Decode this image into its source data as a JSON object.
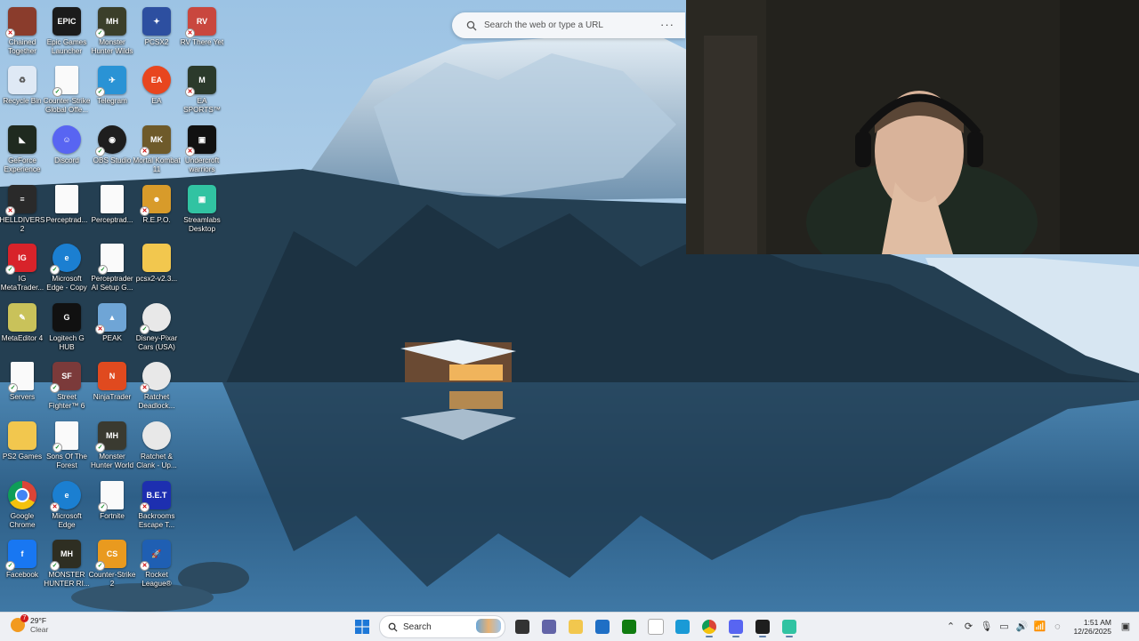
{
  "desktop_icons": [
    {
      "label": "Chained Together",
      "icon": "chained-together-icon",
      "color": "#8a3c2c",
      "glyph": "",
      "badge": "x"
    },
    {
      "label": "Epic Games Launcher",
      "icon": "epic-games-icon",
      "color": "#1b1b1b",
      "glyph": "EPIC",
      "badge": ""
    },
    {
      "label": "Monster Hunter Wilds",
      "icon": "monster-hunter-wilds-icon",
      "color": "#3b3f2a",
      "glyph": "MH",
      "badge": "ok"
    },
    {
      "label": "PCSX2",
      "icon": "pcsx2-icon",
      "color": "#2d4fa0",
      "glyph": "✦",
      "badge": ""
    },
    {
      "label": "RV There Yet",
      "icon": "rv-there-yet-icon",
      "color": "#c9473e",
      "glyph": "RV",
      "badge": "x"
    },
    {
      "label": "Recycle Bin",
      "icon": "recycle-bin-icon",
      "color": "#dfe9f5",
      "glyph": "♻",
      "badge": ""
    },
    {
      "label": "Counter-Strike Global Offe...",
      "icon": "document-icon",
      "color": "page",
      "glyph": "",
      "badge": "ok"
    },
    {
      "label": "Telegram",
      "icon": "telegram-icon",
      "color": "#2a93d5",
      "glyph": "✈",
      "badge": "ok"
    },
    {
      "label": "EA",
      "icon": "ea-icon",
      "color": "#e8461f",
      "glyph": "EA",
      "badge": ""
    },
    {
      "label": "EA SPORTS™ Madden N...",
      "icon": "madden-icon",
      "color": "#2b3a2b",
      "glyph": "M",
      "badge": "x"
    },
    {
      "label": "GeForce Experience",
      "icon": "geforce-icon",
      "color": "#1f2a1f",
      "glyph": "◣",
      "badge": ""
    },
    {
      "label": "Discord",
      "icon": "discord-icon",
      "color": "#5865f2",
      "glyph": "☺",
      "badge": ""
    },
    {
      "label": "OBS Studio",
      "icon": "obs-icon",
      "color": "#1e1e1e",
      "glyph": "◉",
      "badge": "ok"
    },
    {
      "label": "Mortal Kombat 11",
      "icon": "mortal-kombat-icon",
      "color": "#6e5a2a",
      "glyph": "MK",
      "badge": "x"
    },
    {
      "label": "Undercroft warriors",
      "icon": "undercroft-icon",
      "color": "#111111",
      "glyph": "▣",
      "badge": "x"
    },
    {
      "label": "HELLDIVERS 2",
      "icon": "helldivers-icon",
      "color": "#2a2a2a",
      "glyph": "≡",
      "badge": "x"
    },
    {
      "label": "Perceptrad...",
      "icon": "document-icon",
      "color": "page",
      "glyph": "",
      "badge": ""
    },
    {
      "label": "Perceptrad...",
      "icon": "document-icon",
      "color": "page",
      "glyph": "",
      "badge": ""
    },
    {
      "label": "R.E.P.O.",
      "icon": "repo-icon",
      "color": "#d89b2a",
      "glyph": "☻",
      "badge": "x"
    },
    {
      "label": "Streamlabs Desktop",
      "icon": "streamlabs-icon",
      "color": "#31c3a2",
      "glyph": "▣",
      "badge": ""
    },
    {
      "label": "IG MetaTrader...",
      "icon": "ig-icon",
      "color": "#d8232a",
      "glyph": "IG",
      "badge": "ok"
    },
    {
      "label": "Microsoft Edge - Copy",
      "icon": "edge-icon",
      "color": "#1b7fd1",
      "glyph": "e",
      "badge": "ok"
    },
    {
      "label": "Perceptrader AI Setup G...",
      "icon": "chrome-doc-icon",
      "color": "page",
      "glyph": "",
      "badge": "ok"
    },
    {
      "label": "pcsx2-v2.3...",
      "icon": "folder-icon",
      "color": "#f2c74e",
      "glyph": "",
      "badge": ""
    },
    {
      "label": "MetaEditor 4",
      "icon": "metaeditor-icon",
      "color": "#c9c25a",
      "glyph": "✎",
      "badge": ""
    },
    {
      "label": "Logitech G HUB",
      "icon": "logitech-icon",
      "color": "#111111",
      "glyph": "G",
      "badge": ""
    },
    {
      "label": "PEAK",
      "icon": "peak-icon",
      "color": "#6fa5d6",
      "glyph": "▲",
      "badge": "x"
    },
    {
      "label": "Disney-Pixar Cars (USA)",
      "icon": "disc-icon",
      "color": "#e8e8e8",
      "glyph": "",
      "badge": "ok"
    },
    {
      "label": "Servers",
      "icon": "document-icon",
      "color": "page",
      "glyph": "",
      "badge": "ok"
    },
    {
      "label": "Street Fighter™ 6",
      "icon": "street-fighter-icon",
      "color": "#7b3a3a",
      "glyph": "SF",
      "badge": "ok"
    },
    {
      "label": "NinjaTrader",
      "icon": "ninjatrader-icon",
      "color": "#e04a1f",
      "glyph": "N",
      "badge": ""
    },
    {
      "label": "Ratchet Deadlock...",
      "icon": "disc-icon",
      "color": "#e8e8e8",
      "glyph": "",
      "badge": "x"
    },
    {
      "label": "PS2 Games",
      "icon": "folder-icon",
      "color": "#f2c74e",
      "glyph": "",
      "badge": ""
    },
    {
      "label": "Sons Of The Forest",
      "icon": "document-icon",
      "color": "page",
      "glyph": "",
      "badge": "ok"
    },
    {
      "label": "Monster Hunter World",
      "icon": "monster-hunter-world-icon",
      "color": "#3a3a30",
      "glyph": "MH",
      "badge": "ok"
    },
    {
      "label": "Ratchet & Clank - Up...",
      "icon": "disc-icon",
      "color": "#e8e8e8",
      "glyph": "",
      "badge": ""
    },
    {
      "label": "Google Chrome",
      "icon": "chrome-icon",
      "color": "chrome",
      "glyph": "",
      "badge": ""
    },
    {
      "label": "Microsoft Edge",
      "icon": "edge-icon",
      "color": "#1b7fd1",
      "glyph": "e",
      "badge": "x"
    },
    {
      "label": "Fortnite",
      "icon": "document-icon",
      "color": "page",
      "glyph": "",
      "badge": "ok"
    },
    {
      "label": "Backrooms Escape T...",
      "icon": "backrooms-icon",
      "color": "#1d2fb0",
      "glyph": "B.E.T",
      "badge": "x"
    },
    {
      "label": "Facebook",
      "icon": "facebook-icon",
      "color": "#1877f2",
      "glyph": "f",
      "badge": "ok"
    },
    {
      "label": "MONSTER HUNTER RI...",
      "icon": "monster-hunter-rise-icon",
      "color": "#2e2e22",
      "glyph": "MH",
      "badge": "ok"
    },
    {
      "label": "Counter-Strike 2",
      "icon": "cs2-icon",
      "color": "#e99a1f",
      "glyph": "CS",
      "badge": "ok"
    },
    {
      "label": "Rocket League®",
      "icon": "rocket-league-icon",
      "color": "#1f5fb3",
      "glyph": "🚀",
      "badge": "x"
    }
  ],
  "browser_search": {
    "placeholder": "Search the web or type a URL",
    "more_label": "···"
  },
  "taskbar": {
    "weather": {
      "temp": "29°F",
      "condition": "Clear",
      "alert_count": "7"
    },
    "search_label": "Search",
    "clock": {
      "time": "1:51 AM",
      "date": "12/26/2025"
    },
    "apps": [
      {
        "name": "start-button",
        "icon": "windows-start-icon",
        "color": "#1e78d7"
      },
      {
        "name": "taskview-button",
        "icon": "task-view-icon",
        "color": "#333333"
      },
      {
        "name": "teams-button",
        "icon": "teams-icon",
        "color": "#6264a7"
      },
      {
        "name": "file-explorer-button",
        "icon": "folder-icon",
        "color": "#f2c74e"
      },
      {
        "name": "store-button",
        "icon": "store-icon",
        "color": "#1f6fc5"
      },
      {
        "name": "xbox-button",
        "icon": "xbox-icon",
        "color": "#107c10"
      },
      {
        "name": "notepad-button",
        "icon": "document-icon",
        "color": "#ffffff"
      },
      {
        "name": "remote-desktop-button",
        "icon": "monitor-icon",
        "color": "#1a9ad6"
      },
      {
        "name": "chrome-button",
        "icon": "chrome-icon",
        "color": "chrome"
      },
      {
        "name": "discord-button",
        "icon": "discord-icon",
        "color": "#5865f2"
      },
      {
        "name": "obs-button",
        "icon": "obs-icon",
        "color": "#1e1e1e"
      },
      {
        "name": "streamlabs-button",
        "icon": "streamlabs-icon",
        "color": "#31c3a2"
      }
    ],
    "tray": [
      {
        "name": "show-hidden-icons",
        "glyph": "⌃"
      },
      {
        "name": "sync-icon",
        "glyph": "⟳"
      },
      {
        "name": "microphone-icon",
        "glyph": "🎙"
      },
      {
        "name": "display-icon",
        "glyph": "▭"
      },
      {
        "name": "volume-icon",
        "glyph": "🔊"
      },
      {
        "name": "network-icon",
        "glyph": "📶"
      },
      {
        "name": "chat-icon",
        "glyph": "◌"
      }
    ]
  }
}
